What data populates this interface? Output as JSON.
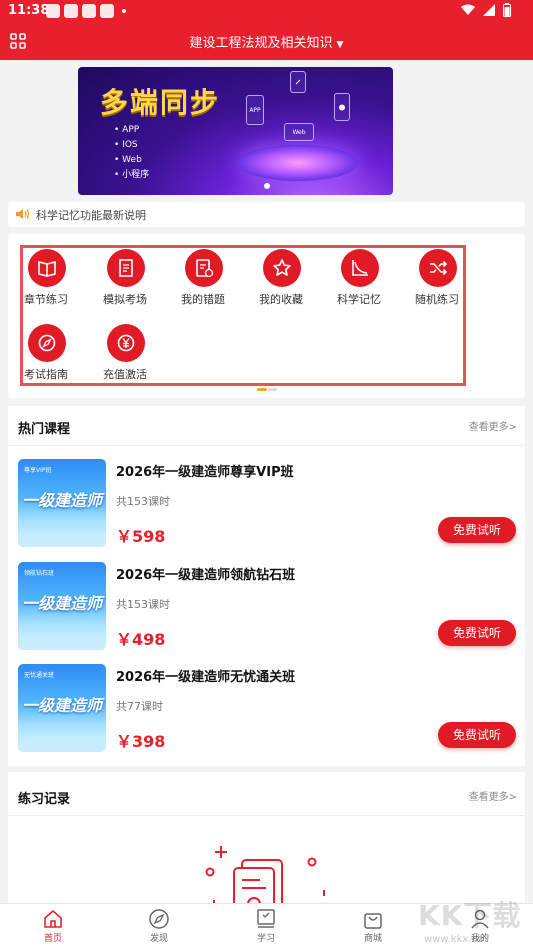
{
  "status_bar": {
    "time": "11:38"
  },
  "header": {
    "title": "建设工程法规及相关知识"
  },
  "banner": {
    "title": "多端同步",
    "platforms": [
      "APP",
      "IOS",
      "Web",
      "小程序"
    ],
    "card_labels": [
      "APP",
      "Web"
    ]
  },
  "notice": {
    "text": "科学记忆功能最新说明"
  },
  "quick_menu": {
    "items": [
      {
        "label": "章节练习",
        "icon": "book-icon"
      },
      {
        "label": "模拟考场",
        "icon": "exam-paper-icon"
      },
      {
        "label": "我的错题",
        "icon": "wrong-answers-icon"
      },
      {
        "label": "我的收藏",
        "icon": "star-icon"
      },
      {
        "label": "科学记忆",
        "icon": "memory-curve-icon"
      },
      {
        "label": "随机练习",
        "icon": "shuffle-icon"
      },
      {
        "label": "考试指南",
        "icon": "compass-icon"
      },
      {
        "label": "充值激活",
        "icon": "yen-icon"
      }
    ]
  },
  "hot_courses": {
    "title": "热门课程",
    "more": "查看更多>",
    "thumb_text": "一级建造师",
    "courses": [
      {
        "title": "2026年一级建造师尊享VIP班",
        "hours": "共153课时",
        "price": "￥598",
        "button": "免费试听",
        "tag": "尊享VIP班"
      },
      {
        "title": "2026年一级建造师领航钻石班",
        "hours": "共153课时",
        "price": "￥498",
        "button": "免费试听",
        "tag": "领航钻石班"
      },
      {
        "title": "2026年一级建造师无忧通关班",
        "hours": "共77课时",
        "price": "￥398",
        "button": "免费试听",
        "tag": "无忧通关班"
      }
    ]
  },
  "practice_records": {
    "title": "练习记录",
    "more": "查看更多>"
  },
  "tabbar": {
    "items": [
      {
        "label": "首页",
        "icon": "home-icon",
        "active": true
      },
      {
        "label": "发现",
        "icon": "compass-icon",
        "active": false
      },
      {
        "label": "学习",
        "icon": "study-icon",
        "active": false
      },
      {
        "label": "商城",
        "icon": "shop-bag-icon",
        "active": false
      },
      {
        "label": "我的",
        "icon": "user-icon",
        "active": false
      }
    ]
  },
  "watermark": {
    "brand": "KK下载",
    "url": "www.kkx.net"
  },
  "colors": {
    "brand_red": "#e8202d",
    "price_red": "#e8202d",
    "quick_box_border": "#e8505a"
  }
}
